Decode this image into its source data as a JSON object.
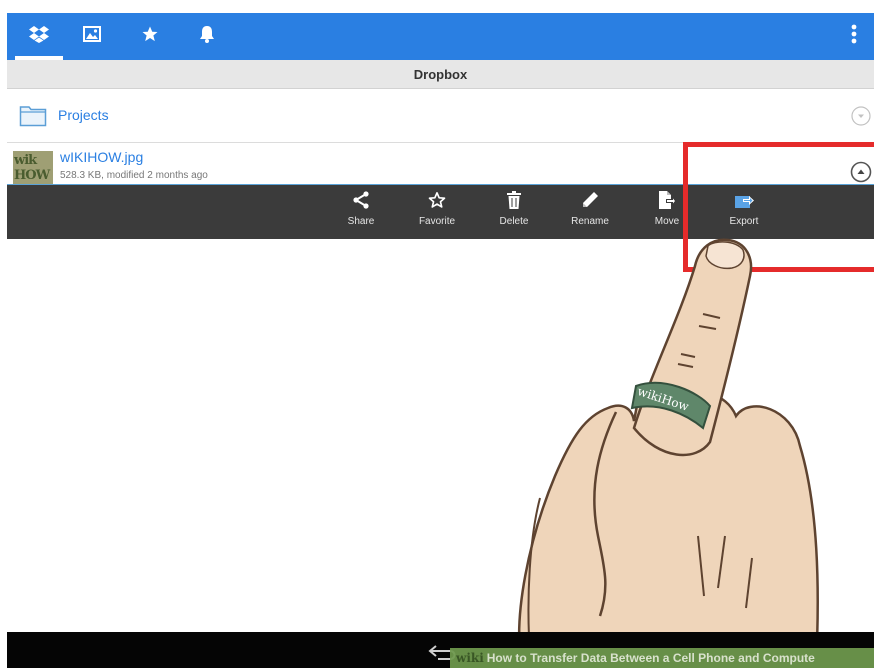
{
  "toolbar": {
    "tabs": [
      {
        "icon": "dropbox-icon",
        "active": true
      },
      {
        "icon": "photos-icon",
        "active": false
      },
      {
        "icon": "favorites-star-icon",
        "active": false
      },
      {
        "icon": "notifications-bell-icon",
        "active": false
      }
    ],
    "overflow_icon": "overflow-menu-icon"
  },
  "path": {
    "title": "Dropbox"
  },
  "files": [
    {
      "name": "Projects",
      "type": "folder",
      "icon": "folder-icon"
    },
    {
      "name": "wIKIHOW.jpg",
      "type": "image",
      "details": "528.3 KB, modified 2 months ago",
      "thumbnail_text": "wik HOW"
    }
  ],
  "action_bar": {
    "actions": [
      {
        "label": "Share",
        "icon": "share-icon"
      },
      {
        "label": "Favorite",
        "icon": "star-outline-icon"
      },
      {
        "label": "Delete",
        "icon": "trash-icon"
      },
      {
        "label": "Rename",
        "icon": "pencil-icon"
      },
      {
        "label": "Move",
        "icon": "move-file-icon"
      },
      {
        "label": "Export",
        "icon": "export-icon"
      }
    ]
  },
  "overlay": {
    "ring_text": "wikiHow",
    "watermark_brand": "wiki",
    "watermark_title": "How to Transfer Data Between a Cell Phone and Compute"
  },
  "colors": {
    "accent": "#2a7fe2",
    "action_bar_bg": "#3b3b3b",
    "highlight": "#e52b2b",
    "watermark_bg": "#6f9a4e"
  }
}
